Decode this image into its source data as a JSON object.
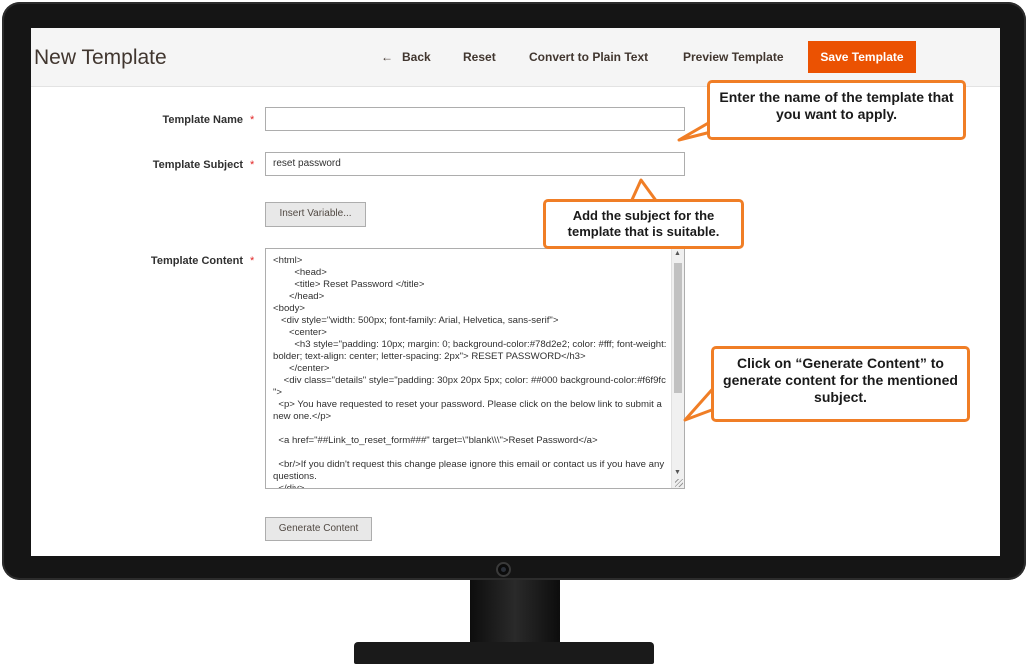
{
  "header": {
    "title": "New Template",
    "back_label": "Back",
    "reset_label": "Reset",
    "convert_label": "Convert to Plain Text",
    "preview_label": "Preview Template",
    "save_label": "Save Template"
  },
  "form": {
    "template_name": {
      "label": "Template Name",
      "required_mark": "*",
      "value": ""
    },
    "template_subject": {
      "label": "Template Subject",
      "required_mark": "*",
      "value": "reset password"
    },
    "insert_variable_label": "Insert Variable...",
    "template_content": {
      "label": "Template Content",
      "required_mark": "*",
      "value": "<html>\n        <head>\n        <title> Reset Password </title>\n      </head>\n<body>\n   <div style=\"width: 500px; font-family: Arial, Helvetica, sans-serif\">\n      <center>\n        <h3 style=\"padding: 10px; margin: 0; background-color:#78d2e2; color: #fff; font-weight: bolder; text-align: center; letter-spacing: 2px\"> RESET PASSWORD</h3>\n      </center>\n    <div class=\"details\" style=\"padding: 30px 20px 5px; color: ##000 background-color:#f6f9fc \">\n  <p> You have requested to reset your password. Please click on the below link to submit a new one.</p>\n\n  <a href=\"##Link_to_reset_form###\" target=\\\"blank\\\\\\\">Reset Password</a>\n\n  <br/>If you didn't request this change please ignore this email or contact us if you have any questions.\n  </div>"
    },
    "generate_label": "Generate Content"
  },
  "callouts": {
    "name_tip": "Enter the name of the template that you want to apply.",
    "subject_tip": "Add the subject for the template that is suitable.",
    "generate_tip": "Click on “Generate Content” to generate content for the mentioned subject."
  },
  "colors": {
    "accent": "#eb5202",
    "callout_border": "#f07e26",
    "required": "#e22626"
  }
}
